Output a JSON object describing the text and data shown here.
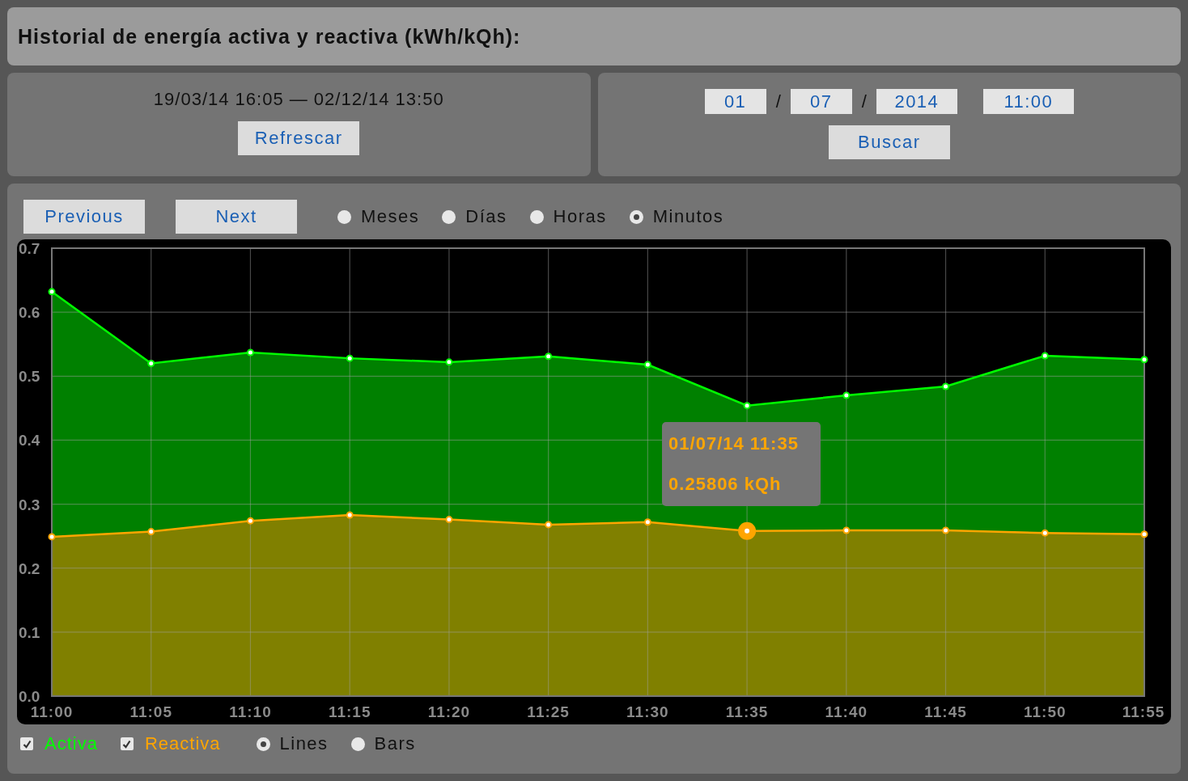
{
  "header": {
    "title": "Historial de energía activa y reactiva (kWh/kQh):"
  },
  "range_panel": {
    "range": "19/03/14 16:05 — 02/12/14 13:50",
    "button": "Refrescar"
  },
  "search_panel": {
    "day": "01",
    "separator_1": "/",
    "month": "07",
    "separator_2": "/",
    "year": "2014",
    "time": "11:00",
    "button": "Buscar"
  },
  "nav_buttons": [
    "Previous",
    "Next"
  ],
  "granularity": [
    {
      "label": "Meses",
      "selected": false
    },
    {
      "label": "Días",
      "selected": false
    },
    {
      "label": "Horas",
      "selected": false
    },
    {
      "label": "Minutos",
      "selected": true
    }
  ],
  "chart_data": {
    "type": "area",
    "grid": true,
    "categories": [
      "11:00",
      "11:05",
      "11:10",
      "11:15",
      "11:20",
      "11:25",
      "11:30",
      "11:35",
      "11:40",
      "11:45",
      "11:50",
      "11:55"
    ],
    "ylim": [
      0,
      0.7
    ],
    "yticks": [
      {
        "value": 0,
        "label": "0.0"
      },
      {
        "value": 0.1,
        "label": "0.1"
      },
      {
        "value": 0.2,
        "label": "0.2"
      },
      {
        "value": 0.3,
        "label": "0.3"
      },
      {
        "value": 0.4,
        "label": "0.4"
      },
      {
        "value": 0.5,
        "label": "0.5"
      },
      {
        "value": 0.6,
        "label": "0.6"
      },
      {
        "value": 0.7,
        "label": "0.7"
      }
    ],
    "series": [
      {
        "name": "Activa",
        "color": "#00ff00",
        "values": [
          0.632,
          0.52,
          0.537,
          0.528,
          0.522,
          0.531,
          0.518,
          0.454,
          0.47,
          0.484,
          0.532,
          0.526
        ]
      },
      {
        "name": "Reactiva",
        "color": "#ffa500",
        "values": [
          0.249,
          0.257,
          0.274,
          0.283,
          0.276,
          0.268,
          0.272,
          0.258,
          0.259,
          0.259,
          0.255,
          0.253
        ]
      }
    ]
  },
  "hover": {
    "title": "01/07/14 11:35",
    "value": "0.25806 kQh",
    "series": [
      {
        "selected": false
      },
      {
        "selected": true
      }
    ],
    "points": [
      {
        "selected": false
      },
      {
        "selected": false
      },
      {
        "selected": false
      },
      {
        "selected": false
      },
      {
        "selected": false
      },
      {
        "selected": false
      },
      {
        "selected": false
      },
      {
        "selected": true
      },
      {
        "selected": false
      },
      {
        "selected": false
      },
      {
        "selected": false
      },
      {
        "selected": false
      }
    ]
  },
  "legend": [
    {
      "checked": true
    },
    {
      "checked": true
    }
  ],
  "chart_mode": [
    {
      "label": "Lines",
      "selected": true
    },
    {
      "label": "Bars",
      "selected": false
    }
  ]
}
